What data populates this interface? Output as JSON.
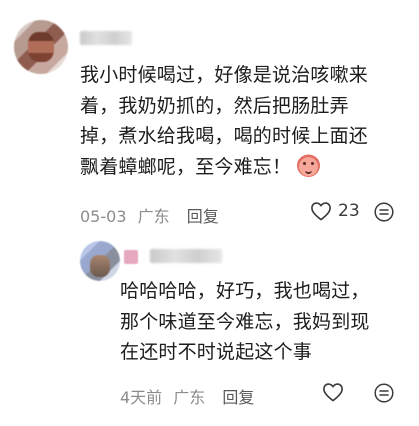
{
  "main_comment": {
    "lines": [
      "我小时候喝过，好像是说治咳嗽来",
      "着，我奶奶抓的，然后把肠肚弄",
      "掉，煮水给我喝，喝的时候上面还",
      "飘着蟑螂呢，至今难忘！"
    ],
    "date": "05-03",
    "location": "广东",
    "reply_label": "回复",
    "likes": "23",
    "emoji": "crying-face-emoji"
  },
  "reply_comment": {
    "lines": [
      "哈哈哈哈，好巧，我也喝过，",
      "那个味道至今难忘，我妈到现",
      "在还时不时说起这个事"
    ],
    "time": "4天前",
    "location": "广东",
    "reply_label": "回复"
  },
  "icons": {
    "like": "heart-outline-icon",
    "more": "more-options-icon"
  },
  "colors": {
    "text": "#1d1d1d",
    "meta": "#8c8c8c",
    "reply_label": "#595959",
    "icon": "#3a3a3a"
  }
}
